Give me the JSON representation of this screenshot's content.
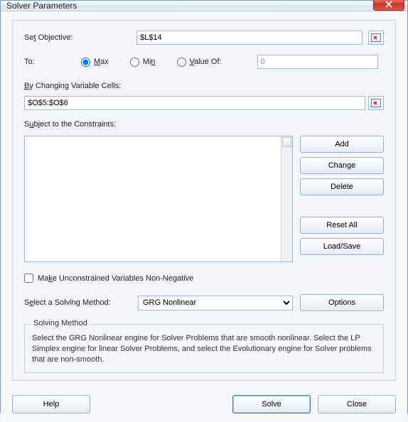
{
  "window": {
    "title": "Solver Parameters"
  },
  "objective": {
    "label_prefix": "Se",
    "label_ul": "t",
    "label_suffix": " Objective:",
    "value": "$L$14"
  },
  "to": {
    "label": "To:",
    "max_ul": "M",
    "max_rest": "ax",
    "min_pre": "Mi",
    "min_ul": "n",
    "valueof_ul": "V",
    "valueof_rest": "alue Of:",
    "valueof_value": "0",
    "selected": "max"
  },
  "cells": {
    "label_ul": "B",
    "label_rest": "y Changing Variable Cells:",
    "value": "$O$5:$O$6"
  },
  "constraints": {
    "label_pre": "S",
    "label_ul": "u",
    "label_post": "bject to the Constraints:",
    "items": []
  },
  "side_buttons": {
    "add_ul": "A",
    "add_rest": "dd",
    "change_ul": "C",
    "change_rest": "hange",
    "delete_ul": "D",
    "delete_rest": "elete",
    "reset_ul": "R",
    "reset_rest": "eset All",
    "loadsave_ul": "L",
    "loadsave_rest": "oad/Save"
  },
  "unconstrained": {
    "pre": "Ma",
    "ul": "k",
    "post": "e Unconstrained Variables Non-Negative",
    "checked": false
  },
  "method": {
    "label_pre": "S",
    "label_ul": "e",
    "label_post": "lect a Solving Method:",
    "selected": "GRG Nonlinear",
    "options_pre": "O",
    "options_ul": "p",
    "options_post": "tions"
  },
  "group": {
    "legend": "Solving Method",
    "desc": "Select the GRG Nonlinear engine for Solver Problems that are smooth nonlinear. Select the LP Simplex engine for linear Solver Problems, and select the Evolutionary engine for Solver problems that are non-smooth."
  },
  "footer": {
    "help_ul": "H",
    "help_rest": "elp",
    "solve_ul": "S",
    "solve_rest": "olve",
    "close_pre": "Cl",
    "close_ul": "o",
    "close_post": "se"
  }
}
